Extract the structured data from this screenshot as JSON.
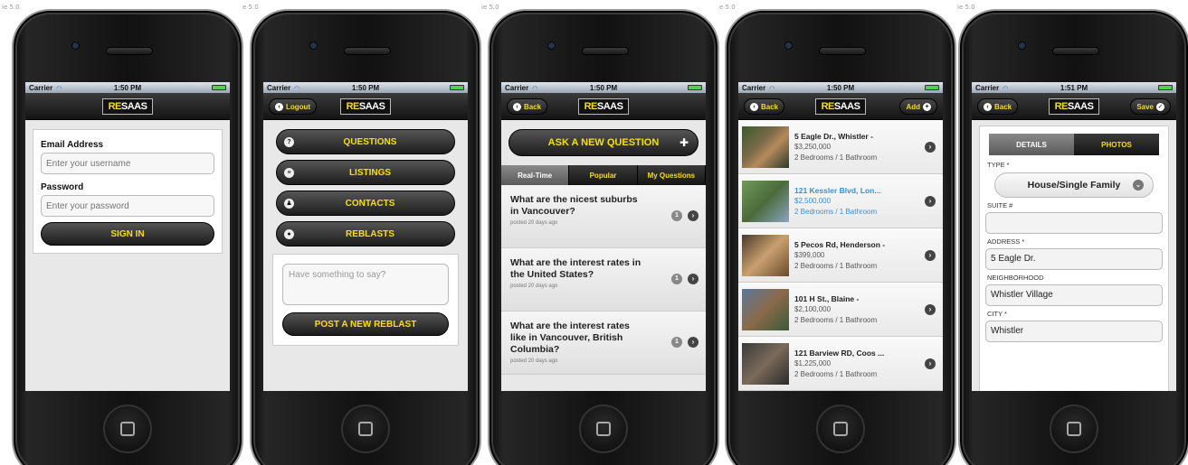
{
  "status": {
    "carrier": "Carrier",
    "time_a": "1:50 PM",
    "time_b": "1:51 PM"
  },
  "logo": {
    "re": "RE",
    "saas": "SAAS"
  },
  "screen1": {
    "email_label": "Email Address",
    "email_placeholder": "Enter your username",
    "password_label": "Password",
    "password_placeholder": "Enter your password",
    "signin_label": "SIGN IN"
  },
  "screen2": {
    "back_label": "Logout",
    "menu": [
      {
        "label": "QUESTIONS",
        "icon": "?"
      },
      {
        "label": "LISTINGS",
        "icon": "≡"
      },
      {
        "label": "CONTACTS",
        "icon": "♟"
      },
      {
        "label": "REBLASTS",
        "icon": "●"
      }
    ],
    "reblast_placeholder": "Have something to say?",
    "post_label": "POST A NEW REBLAST"
  },
  "screen3": {
    "back_label": "Back",
    "ask_label": "ASK A NEW QUESTION",
    "tabs": [
      "Real-Time",
      "Popular",
      "My Questions"
    ],
    "questions": [
      {
        "text": "What are the nicest suburbs in Vancouver?",
        "meta": "posted 20 days ago",
        "count": "1"
      },
      {
        "text": "What are the interest rates in the United States?",
        "meta": "posted 20 days ago",
        "count": "1"
      },
      {
        "text": "What are the interest rates like in Vancouver, British Columbia?",
        "meta": "posted 20 days ago",
        "count": "1"
      }
    ]
  },
  "screen4": {
    "back_label": "Back",
    "add_label": "Add",
    "listings": [
      {
        "address": "5 Eagle Dr., Whistler -",
        "price": "$3,250,000",
        "rooms": "2 Bedrooms / 1 Bathroom"
      },
      {
        "address": "121 Kessler Blvd, Lon...",
        "price": "$2,500,000",
        "rooms": "2 Bedrooms / 1 Bathroom"
      },
      {
        "address": "5 Pecos Rd, Henderson -",
        "price": "$399,000",
        "rooms": "2 Bedrooms / 1 Bathroom"
      },
      {
        "address": "101 H St., Blaine -",
        "price": "$2,100,000",
        "rooms": "2 Bedrooms / 1 Bathroom"
      },
      {
        "address": "121 Barview RD, Coos ...",
        "price": "$1,225,000",
        "rooms": "2 Bedrooms / 1 Bathroom"
      }
    ]
  },
  "screen5": {
    "back_label": "Back",
    "save_label": "Save",
    "seg_details": "DETAILS",
    "seg_photos": "PHOTOS",
    "type_label": "TYPE *",
    "type_value": "House/Single Family",
    "suite_label": "SUITE #",
    "suite_value": "",
    "address_label": "ADDRESS *",
    "address_value": "5 Eagle Dr.",
    "neighborhood_label": "NEIGHBORHOOD",
    "neighborhood_value": "Whistler Village",
    "city_label": "CITY *",
    "city_value": "Whistler"
  },
  "edge_labels": [
    "ie 5.0",
    "e 5.0",
    "ie 5.0",
    "e 5.0",
    "ie 5.0"
  ]
}
